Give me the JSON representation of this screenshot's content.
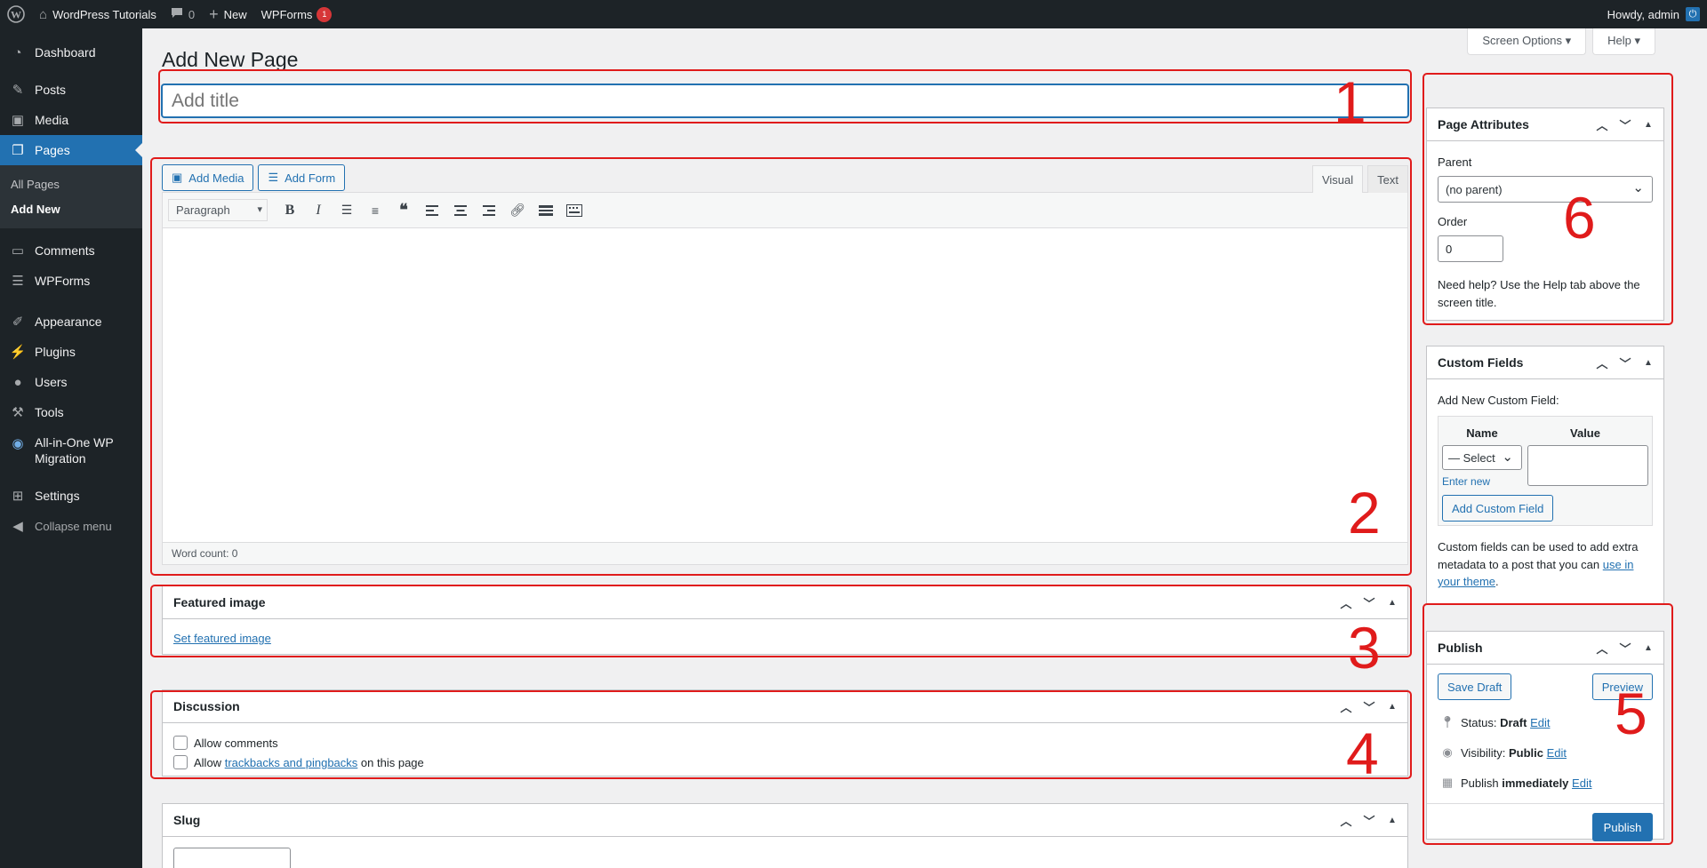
{
  "adminbar": {
    "site_name": "WordPress Tutorials",
    "comments_count": "0",
    "new_label": "New",
    "wpforms_label": "WPForms",
    "wpforms_badge": "1",
    "howdy": "Howdy, admin"
  },
  "sidebar": {
    "items": [
      {
        "label": "Dashboard",
        "icon": "dashboard-icon"
      },
      {
        "label": "Posts",
        "icon": "pin-icon"
      },
      {
        "label": "Media",
        "icon": "media-icon"
      },
      {
        "label": "Pages",
        "icon": "page-icon"
      },
      {
        "label": "Comments",
        "icon": "comment-icon"
      },
      {
        "label": "WPForms",
        "icon": "form-icon"
      },
      {
        "label": "Appearance",
        "icon": "brush-icon"
      },
      {
        "label": "Plugins",
        "icon": "plug-icon"
      },
      {
        "label": "Users",
        "icon": "user-icon"
      },
      {
        "label": "Tools",
        "icon": "wrench-icon"
      },
      {
        "label": "All-in-One WP Migration",
        "icon": "migration-icon"
      },
      {
        "label": "Settings",
        "icon": "settings-icon"
      },
      {
        "label": "Collapse menu",
        "icon": "collapse-icon"
      }
    ],
    "submenu": [
      "All Pages",
      "Add New"
    ]
  },
  "screen_options": "Screen Options ▾",
  "help": "Help ▾",
  "page_title": "Add New Page",
  "title_placeholder": "Add title",
  "editor": {
    "add_media": "Add Media",
    "add_form": "Add Form",
    "tab_visual": "Visual",
    "tab_text": "Text",
    "format": "Paragraph",
    "word_count": "Word count: 0"
  },
  "featured": {
    "title": "Featured image",
    "link": "Set featured image"
  },
  "discussion": {
    "title": "Discussion",
    "allow_comments": "Allow comments",
    "allow_prefix": "Allow",
    "allow_link": "trackbacks and pingbacks",
    "allow_suffix": "on this page"
  },
  "slug": {
    "title": "Slug"
  },
  "page_attributes": {
    "title": "Page Attributes",
    "parent_label": "Parent",
    "parent_value": "(no parent)",
    "order_label": "Order",
    "order_value": "0",
    "help": "Need help? Use the Help tab above the screen title."
  },
  "custom_fields": {
    "title": "Custom Fields",
    "add_new_label": "Add New Custom Field:",
    "col_name": "Name",
    "col_value": "Value",
    "select": "— Select",
    "enter_new": "Enter new",
    "add_button": "Add Custom Field",
    "note_prefix": "Custom fields can be used to add extra metadata to a post that you can",
    "note_link": "use in your theme",
    "note_suffix": "."
  },
  "publish": {
    "title": "Publish",
    "save_draft": "Save Draft",
    "preview": "Preview",
    "status_label": "Status:",
    "status_value": "Draft",
    "visibility_label": "Visibility:",
    "visibility_value": "Public",
    "publish_label": "Publish",
    "publish_value": "immediately",
    "edit": "Edit",
    "publish_button": "Publish"
  },
  "annotations": [
    "1",
    "2",
    "3",
    "4",
    "5",
    "6"
  ],
  "colors": {
    "accent": "#2271b1",
    "annotation": "#e01b1b",
    "admin_bg": "#1d2327"
  }
}
